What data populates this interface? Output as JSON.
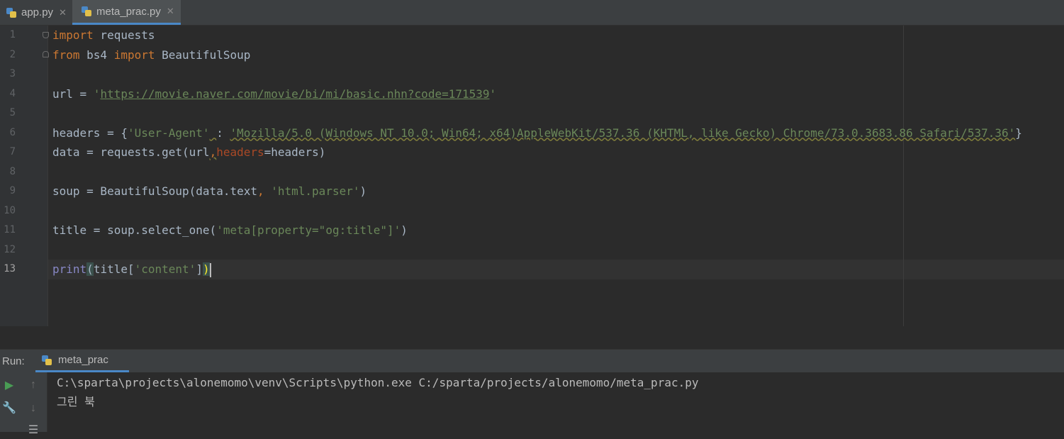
{
  "tabs": [
    {
      "label": "app.py",
      "active": false
    },
    {
      "label": "meta_prac.py",
      "active": true
    }
  ],
  "editor": {
    "line_numbers": [
      "1",
      "2",
      "3",
      "4",
      "5",
      "6",
      "7",
      "8",
      "9",
      "10",
      "11",
      "12",
      "13"
    ],
    "current_line": "13",
    "code": {
      "l1_kw": "import",
      "l1_rest": " requests",
      "l2_kw1": "from",
      "l2_mid": " bs4 ",
      "l2_kw2": "import",
      "l2_rest": " BeautifulSoup",
      "l4_pre": "url = ",
      "l4_q1": "'",
      "l4_url": "https://movie.naver.com/movie/bi/mi/basic.nhn?code=171539",
      "l4_q2": "'",
      "l6_pre": "headers = {",
      "l6_key": "'User-Agent'",
      "l6_sp": " ",
      "l6_colon": ": ",
      "l6_val": "'Mozilla/5.0 (Windows NT 10.0; Win64; x64)AppleWebKit/537.36 (KHTML, like Gecko) Chrome/73.0.3683.86 Safari/537.36'",
      "l6_end": "}",
      "l7_pre": "data = requests.get(url",
      "l7_comma": ",",
      "l7_param": "headers",
      "l7_post": "=headers)",
      "l9_pre": "soup = BeautifulSoup(data.text",
      "l9_comma": ", ",
      "l9_str": "'html.parser'",
      "l9_end": ")",
      "l11_pre": "title = soup.select_one(",
      "l11_str": "'meta[property=\"og:title\"]'",
      "l11_end": ")",
      "l13_fn": "print",
      "l13_open": "(",
      "l13_mid": "title[",
      "l13_str": "'content'",
      "l13_br": "]",
      "l13_close": ")"
    }
  },
  "run": {
    "label": "Run:",
    "tab": "meta_prac",
    "output": [
      "C:\\sparta\\projects\\alonemomo\\venv\\Scripts\\python.exe C:/sparta/projects/alonemomo/meta_prac.py",
      "그린 북"
    ]
  },
  "colors": {
    "background": "#2b2b2b",
    "keyword": "#cc7832",
    "string": "#6a8759",
    "builtin": "#8888c6",
    "accent": "#4a88c7",
    "run_green": "#499c54"
  },
  "icons": [
    "python-file-icon",
    "close-icon",
    "run-icon",
    "wrench-icon",
    "arrow-up-icon",
    "arrow-down-icon",
    "menu-icon"
  ]
}
